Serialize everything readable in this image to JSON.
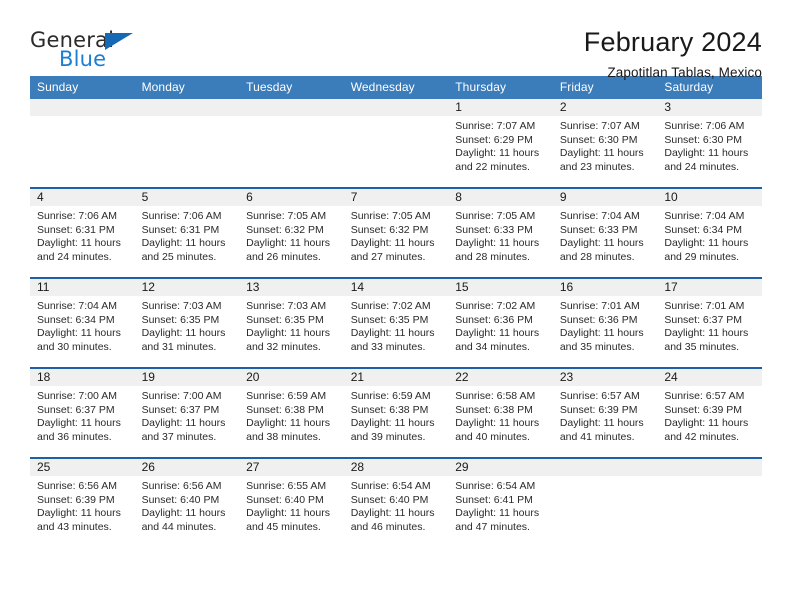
{
  "brand": {
    "name_top": "General",
    "name_bottom": "Blue",
    "flag_icon": "triangle-flag-icon",
    "accent_color": "#1a7fd4",
    "flag_color": "#1669b4"
  },
  "header": {
    "title": "February 2024",
    "subtitle": "Zapotitlan Tablas, Mexico"
  },
  "theme": {
    "header_blue": "#3b7cba",
    "separator_blue": "#1f5fa8",
    "daynum_band": "#f0f0f0"
  },
  "calendar": {
    "weekday_headers": [
      "Sunday",
      "Monday",
      "Tuesday",
      "Wednesday",
      "Thursday",
      "Friday",
      "Saturday"
    ],
    "weeks": [
      [
        {
          "day": "",
          "empty": true,
          "sunrise": "",
          "sunset": "",
          "daylight_line1": "",
          "daylight_line2": ""
        },
        {
          "day": "",
          "empty": true,
          "sunrise": "",
          "sunset": "",
          "daylight_line1": "",
          "daylight_line2": ""
        },
        {
          "day": "",
          "empty": true,
          "sunrise": "",
          "sunset": "",
          "daylight_line1": "",
          "daylight_line2": ""
        },
        {
          "day": "",
          "empty": true,
          "sunrise": "",
          "sunset": "",
          "daylight_line1": "",
          "daylight_line2": ""
        },
        {
          "day": "1",
          "empty": false,
          "sunrise": "Sunrise: 7:07 AM",
          "sunset": "Sunset: 6:29 PM",
          "daylight_line1": "Daylight: 11 hours",
          "daylight_line2": "and 22 minutes."
        },
        {
          "day": "2",
          "empty": false,
          "sunrise": "Sunrise: 7:07 AM",
          "sunset": "Sunset: 6:30 PM",
          "daylight_line1": "Daylight: 11 hours",
          "daylight_line2": "and 23 minutes."
        },
        {
          "day": "3",
          "empty": false,
          "sunrise": "Sunrise: 7:06 AM",
          "sunset": "Sunset: 6:30 PM",
          "daylight_line1": "Daylight: 11 hours",
          "daylight_line2": "and 24 minutes."
        }
      ],
      [
        {
          "day": "4",
          "empty": false,
          "sunrise": "Sunrise: 7:06 AM",
          "sunset": "Sunset: 6:31 PM",
          "daylight_line1": "Daylight: 11 hours",
          "daylight_line2": "and 24 minutes."
        },
        {
          "day": "5",
          "empty": false,
          "sunrise": "Sunrise: 7:06 AM",
          "sunset": "Sunset: 6:31 PM",
          "daylight_line1": "Daylight: 11 hours",
          "daylight_line2": "and 25 minutes."
        },
        {
          "day": "6",
          "empty": false,
          "sunrise": "Sunrise: 7:05 AM",
          "sunset": "Sunset: 6:32 PM",
          "daylight_line1": "Daylight: 11 hours",
          "daylight_line2": "and 26 minutes."
        },
        {
          "day": "7",
          "empty": false,
          "sunrise": "Sunrise: 7:05 AM",
          "sunset": "Sunset: 6:32 PM",
          "daylight_line1": "Daylight: 11 hours",
          "daylight_line2": "and 27 minutes."
        },
        {
          "day": "8",
          "empty": false,
          "sunrise": "Sunrise: 7:05 AM",
          "sunset": "Sunset: 6:33 PM",
          "daylight_line1": "Daylight: 11 hours",
          "daylight_line2": "and 28 minutes."
        },
        {
          "day": "9",
          "empty": false,
          "sunrise": "Sunrise: 7:04 AM",
          "sunset": "Sunset: 6:33 PM",
          "daylight_line1": "Daylight: 11 hours",
          "daylight_line2": "and 28 minutes."
        },
        {
          "day": "10",
          "empty": false,
          "sunrise": "Sunrise: 7:04 AM",
          "sunset": "Sunset: 6:34 PM",
          "daylight_line1": "Daylight: 11 hours",
          "daylight_line2": "and 29 minutes."
        }
      ],
      [
        {
          "day": "11",
          "empty": false,
          "sunrise": "Sunrise: 7:04 AM",
          "sunset": "Sunset: 6:34 PM",
          "daylight_line1": "Daylight: 11 hours",
          "daylight_line2": "and 30 minutes."
        },
        {
          "day": "12",
          "empty": false,
          "sunrise": "Sunrise: 7:03 AM",
          "sunset": "Sunset: 6:35 PM",
          "daylight_line1": "Daylight: 11 hours",
          "daylight_line2": "and 31 minutes."
        },
        {
          "day": "13",
          "empty": false,
          "sunrise": "Sunrise: 7:03 AM",
          "sunset": "Sunset: 6:35 PM",
          "daylight_line1": "Daylight: 11 hours",
          "daylight_line2": "and 32 minutes."
        },
        {
          "day": "14",
          "empty": false,
          "sunrise": "Sunrise: 7:02 AM",
          "sunset": "Sunset: 6:35 PM",
          "daylight_line1": "Daylight: 11 hours",
          "daylight_line2": "and 33 minutes."
        },
        {
          "day": "15",
          "empty": false,
          "sunrise": "Sunrise: 7:02 AM",
          "sunset": "Sunset: 6:36 PM",
          "daylight_line1": "Daylight: 11 hours",
          "daylight_line2": "and 34 minutes."
        },
        {
          "day": "16",
          "empty": false,
          "sunrise": "Sunrise: 7:01 AM",
          "sunset": "Sunset: 6:36 PM",
          "daylight_line1": "Daylight: 11 hours",
          "daylight_line2": "and 35 minutes."
        },
        {
          "day": "17",
          "empty": false,
          "sunrise": "Sunrise: 7:01 AM",
          "sunset": "Sunset: 6:37 PM",
          "daylight_line1": "Daylight: 11 hours",
          "daylight_line2": "and 35 minutes."
        }
      ],
      [
        {
          "day": "18",
          "empty": false,
          "sunrise": "Sunrise: 7:00 AM",
          "sunset": "Sunset: 6:37 PM",
          "daylight_line1": "Daylight: 11 hours",
          "daylight_line2": "and 36 minutes."
        },
        {
          "day": "19",
          "empty": false,
          "sunrise": "Sunrise: 7:00 AM",
          "sunset": "Sunset: 6:37 PM",
          "daylight_line1": "Daylight: 11 hours",
          "daylight_line2": "and 37 minutes."
        },
        {
          "day": "20",
          "empty": false,
          "sunrise": "Sunrise: 6:59 AM",
          "sunset": "Sunset: 6:38 PM",
          "daylight_line1": "Daylight: 11 hours",
          "daylight_line2": "and 38 minutes."
        },
        {
          "day": "21",
          "empty": false,
          "sunrise": "Sunrise: 6:59 AM",
          "sunset": "Sunset: 6:38 PM",
          "daylight_line1": "Daylight: 11 hours",
          "daylight_line2": "and 39 minutes."
        },
        {
          "day": "22",
          "empty": false,
          "sunrise": "Sunrise: 6:58 AM",
          "sunset": "Sunset: 6:38 PM",
          "daylight_line1": "Daylight: 11 hours",
          "daylight_line2": "and 40 minutes."
        },
        {
          "day": "23",
          "empty": false,
          "sunrise": "Sunrise: 6:57 AM",
          "sunset": "Sunset: 6:39 PM",
          "daylight_line1": "Daylight: 11 hours",
          "daylight_line2": "and 41 minutes."
        },
        {
          "day": "24",
          "empty": false,
          "sunrise": "Sunrise: 6:57 AM",
          "sunset": "Sunset: 6:39 PM",
          "daylight_line1": "Daylight: 11 hours",
          "daylight_line2": "and 42 minutes."
        }
      ],
      [
        {
          "day": "25",
          "empty": false,
          "sunrise": "Sunrise: 6:56 AM",
          "sunset": "Sunset: 6:39 PM",
          "daylight_line1": "Daylight: 11 hours",
          "daylight_line2": "and 43 minutes."
        },
        {
          "day": "26",
          "empty": false,
          "sunrise": "Sunrise: 6:56 AM",
          "sunset": "Sunset: 6:40 PM",
          "daylight_line1": "Daylight: 11 hours",
          "daylight_line2": "and 44 minutes."
        },
        {
          "day": "27",
          "empty": false,
          "sunrise": "Sunrise: 6:55 AM",
          "sunset": "Sunset: 6:40 PM",
          "daylight_line1": "Daylight: 11 hours",
          "daylight_line2": "and 45 minutes."
        },
        {
          "day": "28",
          "empty": false,
          "sunrise": "Sunrise: 6:54 AM",
          "sunset": "Sunset: 6:40 PM",
          "daylight_line1": "Daylight: 11 hours",
          "daylight_line2": "and 46 minutes."
        },
        {
          "day": "29",
          "empty": false,
          "sunrise": "Sunrise: 6:54 AM",
          "sunset": "Sunset: 6:41 PM",
          "daylight_line1": "Daylight: 11 hours",
          "daylight_line2": "and 47 minutes."
        },
        {
          "day": "",
          "empty": true,
          "sunrise": "",
          "sunset": "",
          "daylight_line1": "",
          "daylight_line2": ""
        },
        {
          "day": "",
          "empty": true,
          "sunrise": "",
          "sunset": "",
          "daylight_line1": "",
          "daylight_line2": ""
        }
      ]
    ]
  }
}
